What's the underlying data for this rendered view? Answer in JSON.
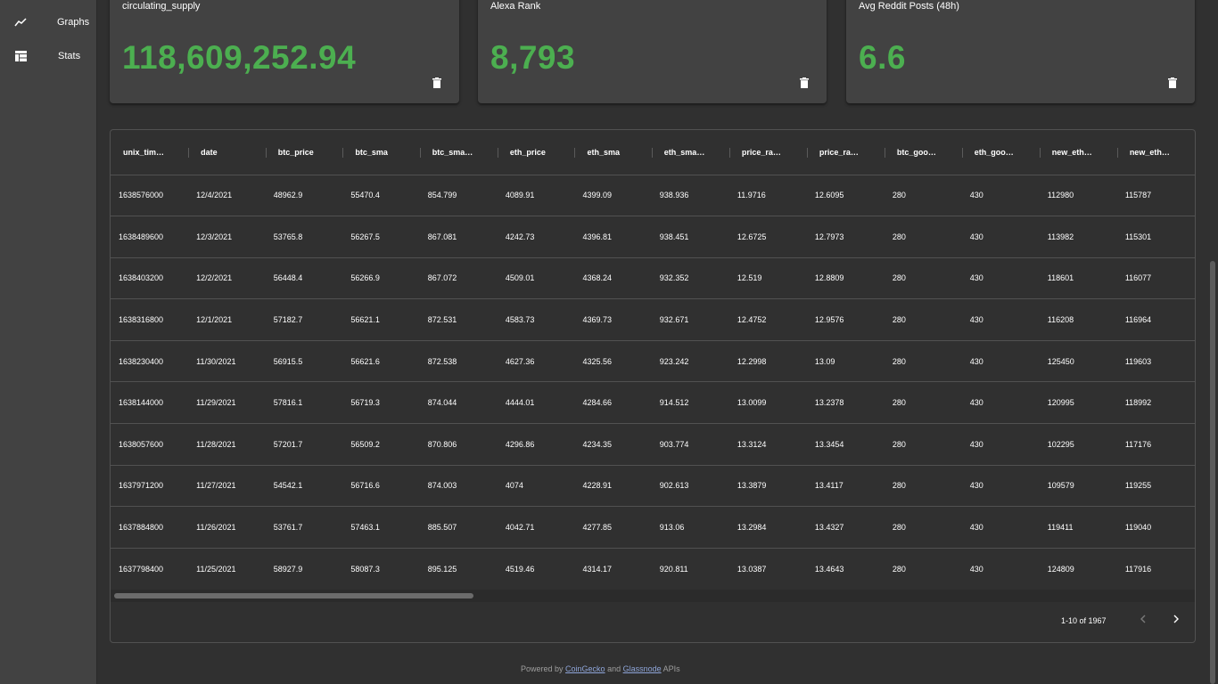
{
  "nav": {
    "graphs_label": "Graphs",
    "stats_label": "Stats"
  },
  "cards": [
    {
      "title": "circulating_supply",
      "value": "118,609,252.94"
    },
    {
      "title": "Alexa Rank",
      "value": "8,793"
    },
    {
      "title": "Avg Reddit Posts (48h)",
      "value": "6.6"
    }
  ],
  "colors": {
    "accent_green": "#4caf50",
    "background": "#303030",
    "surface": "#424242",
    "link": "#8ea5d9"
  },
  "table": {
    "columns": [
      "unix_tim…",
      "date",
      "btc_price",
      "btc_sma",
      "btc_sma…",
      "eth_price",
      "eth_sma",
      "eth_sma…",
      "price_ra…",
      "price_ra…",
      "btc_goo…",
      "eth_goo…",
      "new_eth…",
      "new_eth…"
    ],
    "rows": [
      [
        "1638576000",
        "12/4/2021",
        "48962.9",
        "55470.4",
        "854.799",
        "4089.91",
        "4399.09",
        "938.936",
        "11.9716",
        "12.6095",
        "280",
        "430",
        "112980",
        "115787"
      ],
      [
        "1638489600",
        "12/3/2021",
        "53765.8",
        "56267.5",
        "867.081",
        "4242.73",
        "4396.81",
        "938.451",
        "12.6725",
        "12.7973",
        "280",
        "430",
        "113982",
        "115301"
      ],
      [
        "1638403200",
        "12/2/2021",
        "56448.4",
        "56266.9",
        "867.072",
        "4509.01",
        "4368.24",
        "932.352",
        "12.519",
        "12.8809",
        "280",
        "430",
        "118601",
        "116077"
      ],
      [
        "1638316800",
        "12/1/2021",
        "57182.7",
        "56621.1",
        "872.531",
        "4583.73",
        "4369.73",
        "932.671",
        "12.4752",
        "12.9576",
        "280",
        "430",
        "116208",
        "116964"
      ],
      [
        "1638230400",
        "11/30/2021",
        "56915.5",
        "56621.6",
        "872.538",
        "4627.36",
        "4325.56",
        "923.242",
        "12.2998",
        "13.09",
        "280",
        "430",
        "125450",
        "119603"
      ],
      [
        "1638144000",
        "11/29/2021",
        "57816.1",
        "56719.3",
        "874.044",
        "4444.01",
        "4284.66",
        "914.512",
        "13.0099",
        "13.2378",
        "280",
        "430",
        "120995",
        "118992"
      ],
      [
        "1638057600",
        "11/28/2021",
        "57201.7",
        "56509.2",
        "870.806",
        "4296.86",
        "4234.35",
        "903.774",
        "13.3124",
        "13.3454",
        "280",
        "430",
        "102295",
        "117176"
      ],
      [
        "1637971200",
        "11/27/2021",
        "54542.1",
        "56716.6",
        "874.003",
        "4074",
        "4228.91",
        "902.613",
        "13.3879",
        "13.4117",
        "280",
        "430",
        "109579",
        "119255"
      ],
      [
        "1637884800",
        "11/26/2021",
        "53761.7",
        "57463.1",
        "885.507",
        "4042.71",
        "4277.85",
        "913.06",
        "13.2984",
        "13.4327",
        "280",
        "430",
        "119411",
        "119040"
      ],
      [
        "1637798400",
        "11/25/2021",
        "58927.9",
        "58087.3",
        "895.125",
        "4519.46",
        "4314.17",
        "920.811",
        "13.0387",
        "13.4643",
        "280",
        "430",
        "124809",
        "117916"
      ]
    ]
  },
  "pagination": {
    "range_text": "1-10 of 1967"
  },
  "footer": {
    "prefix": "Powered by ",
    "link1": "CoinGecko",
    "middle": " and ",
    "link2": "Glassnode",
    "suffix": " APIs"
  }
}
